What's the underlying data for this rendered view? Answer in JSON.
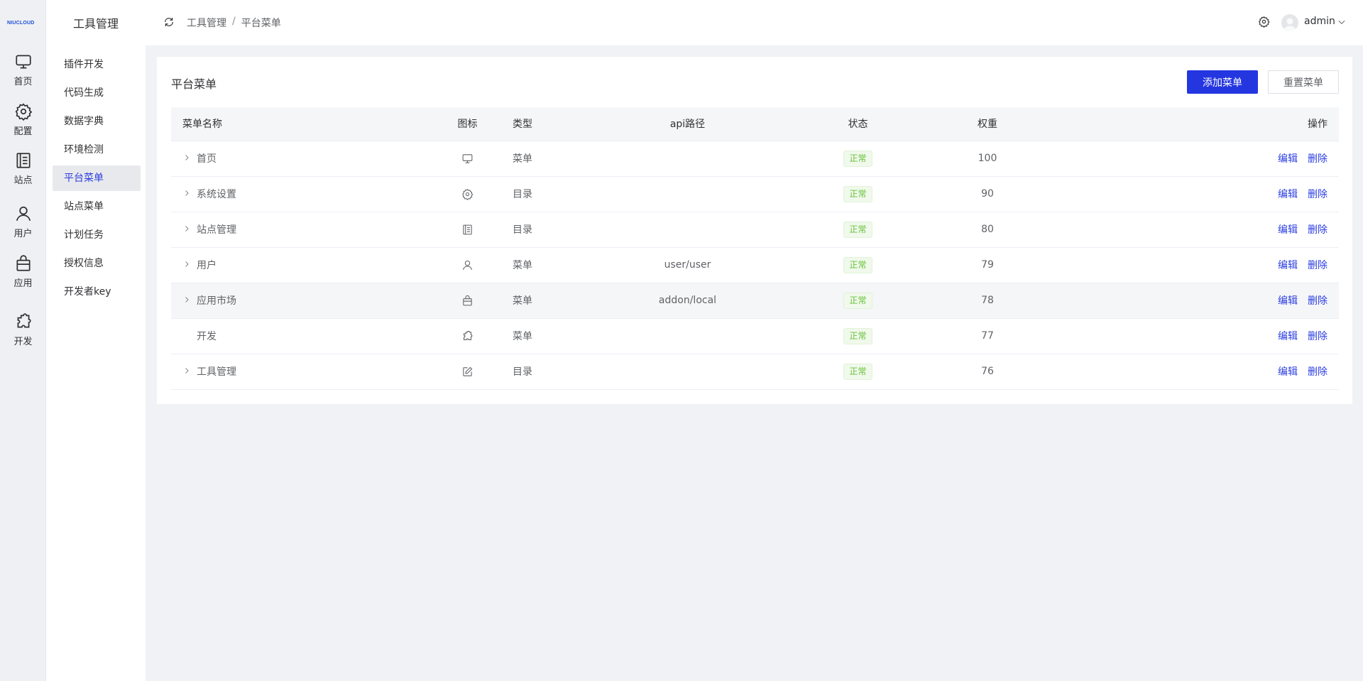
{
  "logo": {
    "text": "NIUCLOUD"
  },
  "rail": {
    "items": [
      {
        "label": "首页",
        "icon": "monitor-icon"
      },
      {
        "label": "配置",
        "icon": "gear-icon"
      },
      {
        "label": "站点",
        "icon": "document-icon"
      },
      {
        "label": "用户",
        "icon": "user-icon"
      },
      {
        "label": "应用",
        "icon": "bag-icon"
      },
      {
        "label": "开发",
        "icon": "puzzle-icon"
      }
    ]
  },
  "submenu": {
    "title": "工具管理",
    "items": [
      {
        "label": "插件开发"
      },
      {
        "label": "代码生成"
      },
      {
        "label": "数据字典"
      },
      {
        "label": "环境检测"
      },
      {
        "label": "平台菜单",
        "active": true
      },
      {
        "label": "站点菜单"
      },
      {
        "label": "计划任务"
      },
      {
        "label": "授权信息"
      },
      {
        "label": "开发者key"
      }
    ]
  },
  "header": {
    "breadcrumb": [
      "工具管理",
      "平台菜单"
    ],
    "separator": "/",
    "user": "admin"
  },
  "card": {
    "title": "平台菜单",
    "add_button": "添加菜单",
    "reset_button": "重置菜单"
  },
  "table": {
    "columns": {
      "name": "菜单名称",
      "icon": "图标",
      "type": "类型",
      "api": "api路径",
      "status": "状态",
      "weight": "权重",
      "ops": "操作"
    },
    "rows": [
      {
        "name": "首页",
        "icon": "monitor-icon",
        "type": "菜单",
        "api": "",
        "status": "正常",
        "weight": "100",
        "expandable": true,
        "edit": "编辑",
        "delete": "删除"
      },
      {
        "name": "系统设置",
        "icon": "gear-icon",
        "type": "目录",
        "api": "",
        "status": "正常",
        "weight": "90",
        "expandable": true,
        "edit": "编辑",
        "delete": "删除"
      },
      {
        "name": "站点管理",
        "icon": "document-icon",
        "type": "目录",
        "api": "",
        "status": "正常",
        "weight": "80",
        "expandable": true,
        "edit": "编辑",
        "delete": "删除"
      },
      {
        "name": "用户",
        "icon": "user-icon",
        "type": "菜单",
        "api": "user/user",
        "status": "正常",
        "weight": "79",
        "expandable": true,
        "edit": "编辑",
        "delete": "删除"
      },
      {
        "name": "应用市场",
        "icon": "bag-icon",
        "type": "菜单",
        "api": "addon/local",
        "status": "正常",
        "weight": "78",
        "expandable": true,
        "edit": "编辑",
        "delete": "删除"
      },
      {
        "name": "开发",
        "icon": "puzzle-icon",
        "type": "菜单",
        "api": "",
        "status": "正常",
        "weight": "77",
        "expandable": false,
        "edit": "编辑",
        "delete": "删除"
      },
      {
        "name": "工具管理",
        "icon": "edit-icon",
        "type": "目录",
        "api": "",
        "status": "正常",
        "weight": "76",
        "expandable": true,
        "edit": "编辑",
        "delete": "删除"
      }
    ]
  },
  "colors": {
    "primary": "#2436e0",
    "active_text": "#2c3ee0",
    "status_green": "#67c23a"
  }
}
